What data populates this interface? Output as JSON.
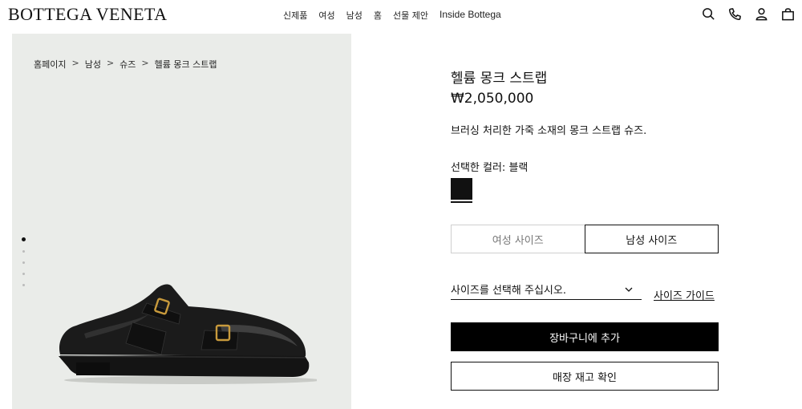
{
  "header": {
    "logo": "BOTTEGA VENETA",
    "nav": [
      "신제품",
      "여성",
      "남성",
      "홈",
      "선물 제안",
      "Inside Bottega"
    ],
    "icons": [
      "search-icon",
      "phone-icon",
      "account-icon",
      "bag-icon"
    ]
  },
  "breadcrumb": {
    "items": [
      "홈페이지",
      "남성",
      "슈즈",
      "헬륨 몽크 스트랩"
    ],
    "separator": ">"
  },
  "gallery": {
    "dot_count": 5,
    "active_index": 0
  },
  "product": {
    "title": "헬륨 몽크 스트랩",
    "price": "₩2,050,000",
    "description": "브러싱 처리한 가죽 소재의 몽크 스트랩 슈즈.",
    "color_label": "선택한 컬러: 블랙",
    "swatch_color": "#111111",
    "size_tabs": {
      "women": "여성 사이즈",
      "men": "남성 사이즈",
      "active": "men"
    },
    "size_select_placeholder": "사이즈를 선택해 주십시오.",
    "size_guide": "사이즈 가이드",
    "add_to_cart": "장바구니에 추가",
    "check_stock": "매장 재고 확인"
  }
}
